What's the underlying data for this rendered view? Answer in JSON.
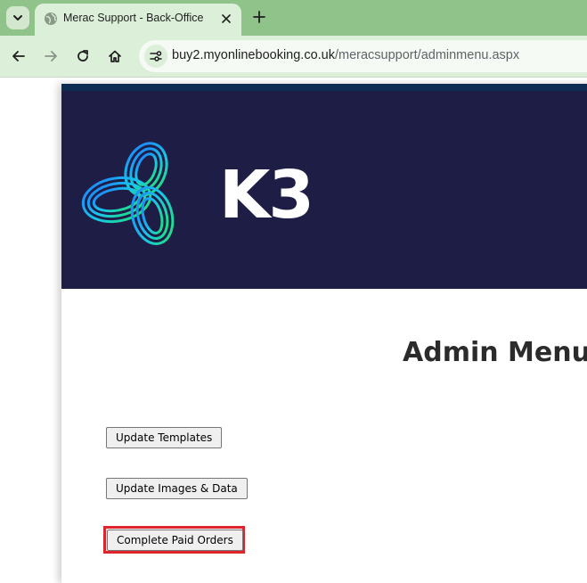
{
  "browser": {
    "tab_title": "Merac Support - Back-Office",
    "url_host": "buy2.myonlinebooking.co.uk",
    "url_path": "/meracsupport/adminmenu.aspx"
  },
  "header": {
    "logo_text": "K3"
  },
  "main": {
    "heading": "Admin Menu",
    "buttons": [
      {
        "label": "Update Templates"
      },
      {
        "label": "Update Images & Data"
      },
      {
        "label": "Complete Paid Orders",
        "highlighted": true
      }
    ]
  },
  "colors": {
    "tabstrip": "#8fc38a",
    "toolbar": "#dcefd8",
    "banner": "#1e1d45",
    "highlight": "#e0242c"
  },
  "icons": [
    "tab-search-icon",
    "globe-icon",
    "close-icon",
    "plus-icon",
    "back-arrow-icon",
    "forward-arrow-icon",
    "reload-icon",
    "home-icon",
    "site-info-icon"
  ]
}
